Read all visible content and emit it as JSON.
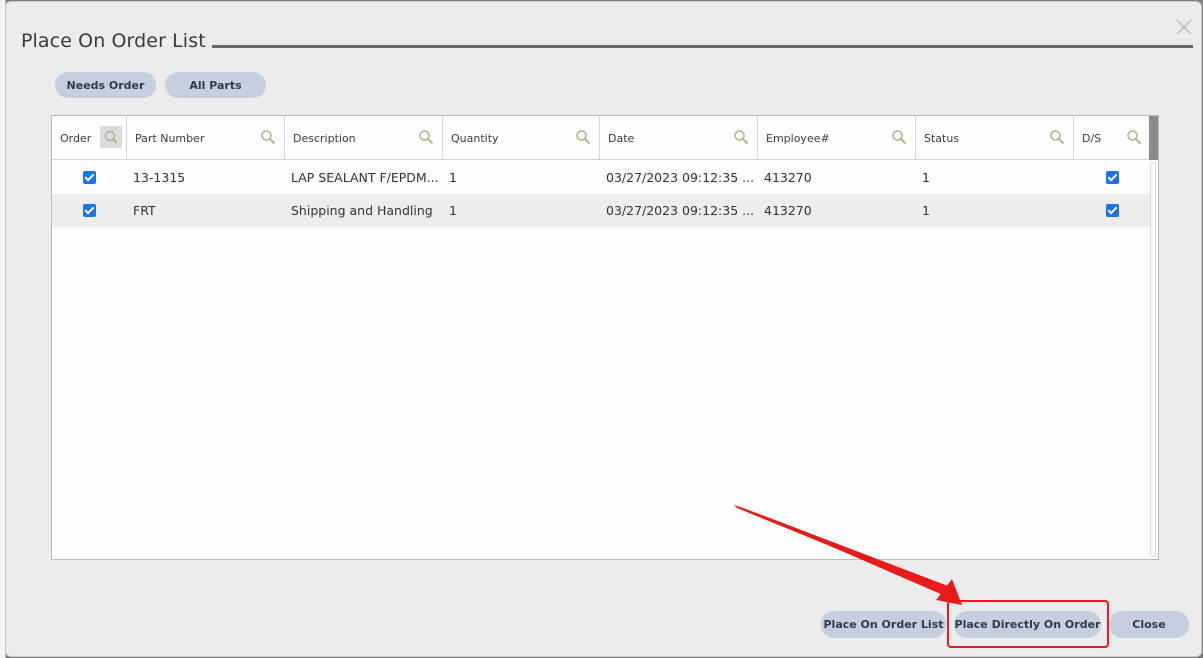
{
  "dialog": {
    "title": "Place On Order List"
  },
  "filters": {
    "needs_order": "Needs Order",
    "all_parts": "All Parts"
  },
  "grid": {
    "columns": [
      "Order",
      "Part Number",
      "Description",
      "Quantity",
      "Date",
      "Employee#",
      "Status",
      "D/S"
    ],
    "rows": [
      {
        "order_checked": true,
        "part_number": "13-1315",
        "description": "LAP SEALANT F/EPDM...",
        "quantity": "1",
        "date": "03/27/2023 09:12:35 ...",
        "employee": "413270",
        "status": "1",
        "ds_checked": true
      },
      {
        "order_checked": true,
        "part_number": "FRT",
        "description": "Shipping and Handling",
        "quantity": "1",
        "date": "03/27/2023 09:12:35 ...",
        "employee": "413270",
        "status": "1",
        "ds_checked": true
      }
    ]
  },
  "footer": {
    "place_on_order_list": "Place On Order List",
    "place_directly_on_order": "Place Directly On Order",
    "close": "Close"
  },
  "annotation": {
    "color": "#e81b1b"
  },
  "colors": {
    "pill_bg": "#c6cfdf",
    "checkbox": "#1a73e8"
  }
}
